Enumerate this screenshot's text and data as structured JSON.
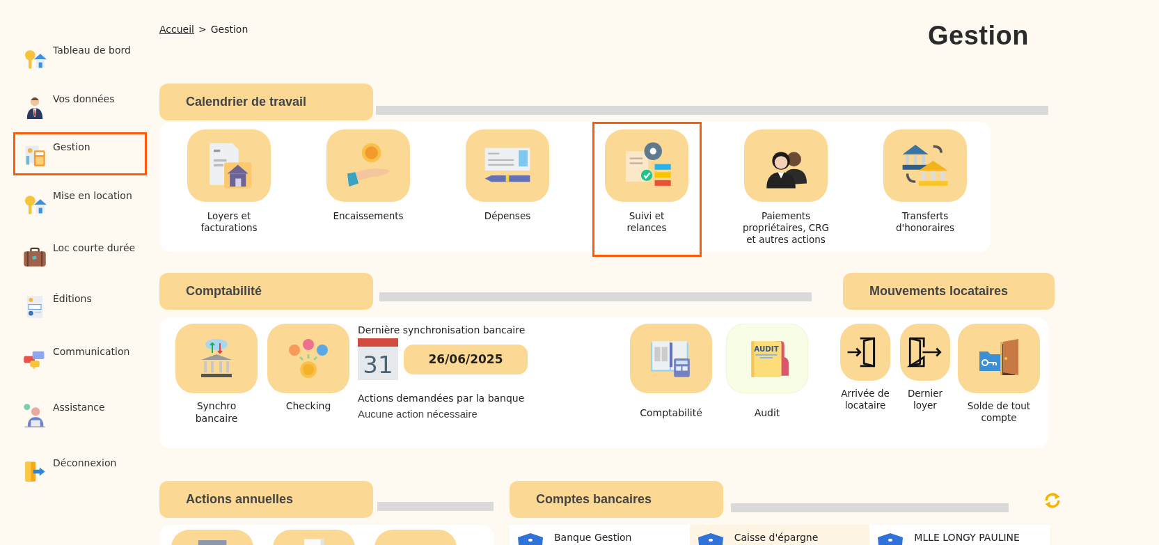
{
  "sidebar": {
    "items": [
      {
        "label": "Tableau de bord",
        "selected": false
      },
      {
        "label": "Vos données",
        "selected": false
      },
      {
        "label": "Gestion",
        "selected": true
      },
      {
        "label": "Mise en location",
        "selected": false
      },
      {
        "label": "Loc courte durée",
        "selected": false
      },
      {
        "label": "Éditions",
        "selected": false
      },
      {
        "label": "Communication",
        "selected": false
      },
      {
        "label": "Assistance",
        "selected": false
      },
      {
        "label": "Déconnexion",
        "selected": false
      }
    ]
  },
  "breadcrumb": {
    "link": "Accueil",
    "separator": ">",
    "current": "Gestion"
  },
  "page_title": "Gestion",
  "calendrier": {
    "title": "Calendrier de travail",
    "tiles": [
      {
        "label": "Loyers et\nfacturations",
        "selected": false
      },
      {
        "label": "Encaissements",
        "selected": false
      },
      {
        "label": "Dépenses",
        "selected": false
      },
      {
        "label": "Suivi et\nrelances",
        "selected": true
      },
      {
        "label": "Paiements\npropriétaires, CRG\net autres actions",
        "selected": false
      },
      {
        "label": "Transferts\nd'honoraires",
        "selected": false
      }
    ]
  },
  "comptabilite": {
    "title": "Comptabilité",
    "tiles": [
      {
        "label": "Synchro\nbancaire",
        "highlighted": false
      },
      {
        "label": "Checking",
        "highlighted": false
      }
    ],
    "sync": {
      "label": "Dernière synchronisation bancaire",
      "calendar_day": "31",
      "date": "26/06/2025",
      "actions_label": "Actions demandées par la banque",
      "actions_status": "Aucune action nécessaire"
    },
    "tiles_right": [
      {
        "label": "Comptabilité",
        "highlighted": false
      },
      {
        "label": "Audit",
        "highlighted": true,
        "icon_text": "AUDIT"
      }
    ]
  },
  "mouvements": {
    "title": "Mouvements locataires",
    "tiles": [
      {
        "label": "Arrivée de\nlocataire"
      },
      {
        "label": "Dernier\nloyer"
      },
      {
        "label": "Solde de tout\ncompte"
      }
    ]
  },
  "actions_annuelles": {
    "title": "Actions annuelles",
    "tiles": [
      {
        "selected": false
      },
      {
        "selected": false
      },
      {
        "selected": false
      }
    ]
  },
  "comptes_bancaires": {
    "title": "Comptes bancaires",
    "accounts": [
      {
        "name": "Banque Gestion",
        "selected": false
      },
      {
        "name": "Caisse d'épargne",
        "selected": true
      },
      {
        "name": "MLLE LONGY PAULINE",
        "selected": false
      }
    ]
  }
}
